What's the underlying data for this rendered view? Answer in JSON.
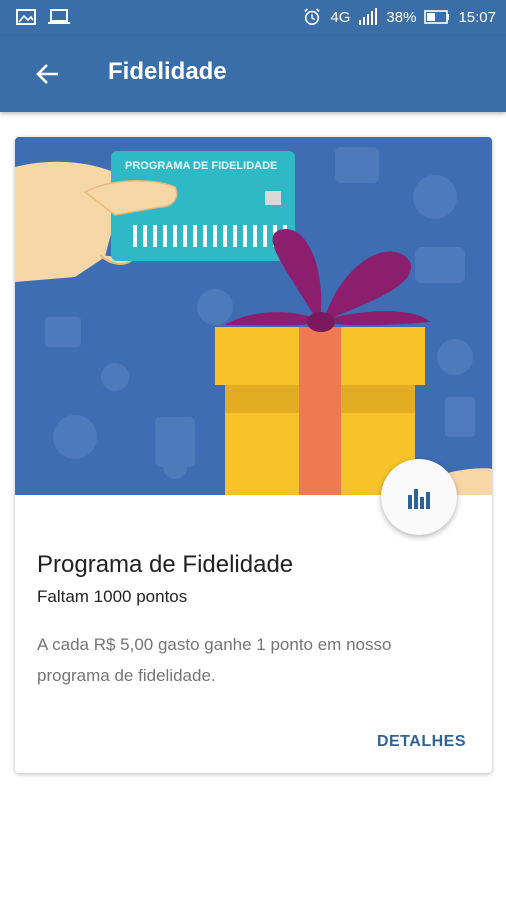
{
  "status_bar": {
    "battery": "38%",
    "time": "15:07",
    "network": "4G"
  },
  "app_bar": {
    "title": "Fidelidade"
  },
  "card": {
    "hero_card_label": "PROGRAMA DE FIDELIDADE",
    "title": "Programa de Fidelidade",
    "subtitle": "Faltam 1000 pontos",
    "description": "A cada R$ 5,00 gasto ganhe 1 ponto em nosso programa de fidelidade.",
    "action_label": "DETALHES"
  },
  "colors": {
    "primary": "#3a6ea8",
    "hero_background": "#3f6db3",
    "gift_yellow": "#f7c328",
    "ribbon_purple": "#8b1f6e",
    "loyalty_card": "#2fb8c5",
    "action_text": "#2f6398"
  }
}
